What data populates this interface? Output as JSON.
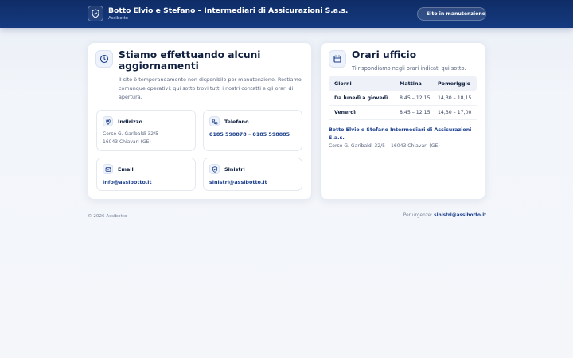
{
  "header": {
    "title": "Botto Elvio e Stefano – Intermediari di Assicurazioni S.a.s.",
    "subtitle": "Assibotto",
    "status_label": "Sito in manutenzione",
    "status_color": "#f5b82e"
  },
  "maintenance": {
    "heading": "Stiamo effettuando alcuni aggiornamenti",
    "body": "Il sito è temporaneamente non disponibile per manutenzione. Restiamo comunque operativi: qui sotto trovi tutti i nostri contatti e gli orari di apertura."
  },
  "contacts": {
    "address": {
      "label": "Indirizzo",
      "line1": "Corso G. Garibaldi 32/5",
      "line2": "16043 Chiavari (GE)"
    },
    "phone": {
      "label": "Telefono",
      "number1": "0185 598878",
      "separator": "–",
      "number2": "0185 598885"
    },
    "email": {
      "label": "Email",
      "value": "info@assibotto.it"
    },
    "claims": {
      "label": "Sinistri",
      "value": "sinistri@assibotto.it"
    }
  },
  "hours": {
    "heading": "Orari ufficio",
    "subtitle": "Ti rispondiamo negli orari indicati qui sotto.",
    "columns": [
      "Giorni",
      "Mattina",
      "Pomeriggio"
    ],
    "rows": [
      [
        "Da lunedì a giovedì",
        "8,45 – 12,15",
        "14,30 – 18,15"
      ],
      [
        "Venerdì",
        "8,45 – 12,15",
        "14,30 – 17,00"
      ]
    ],
    "company_name": "Botto Elvio e Stefano Intermediari di Assicurazioni S.a.s.",
    "company_address": "Corso G. Garibaldi 32/5 – 16043 Chiavari (GE)"
  },
  "footer": {
    "copyright": "© 2026 Assibotto",
    "urgent_label": "Per urgenze:",
    "urgent_email": "sinistri@assibotto.it"
  },
  "colors": {
    "primary": "#0f2c66",
    "link": "#1a3f8c",
    "background": "#f4f6fa"
  }
}
